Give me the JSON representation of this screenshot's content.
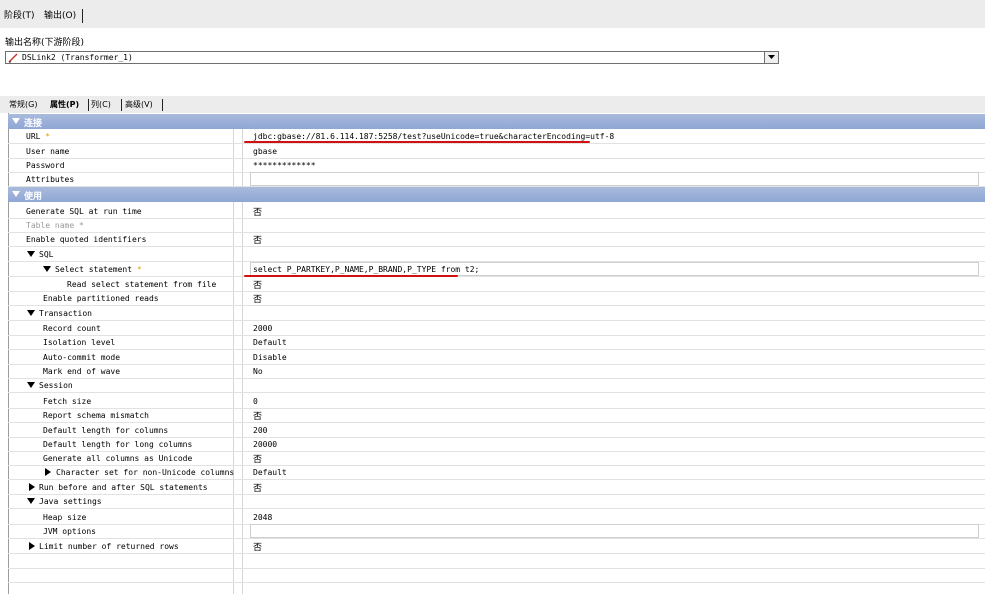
{
  "stage_tabs": [
    {
      "label": "阶段(T)"
    },
    {
      "label": "输出(O)"
    }
  ],
  "output_name_label": "输出名称(下游阶段)",
  "output_select_value": "DSLink2 (Transformer_1)",
  "property_tabs": [
    {
      "label": "常规(G)"
    },
    {
      "label": "属性(P)"
    },
    {
      "label": "列(C)"
    },
    {
      "label": "高级(V)"
    }
  ],
  "sections": {
    "connection": "连接",
    "usage": "使用"
  },
  "connection_rows": [
    {
      "name": "URL",
      "required": "*",
      "value": "jdbc:gbase://81.6.114.187:5258/test?useUnicode=true&characterEncoding=utf-8"
    },
    {
      "name": "User name",
      "value": "gbase"
    },
    {
      "name": "Password",
      "value": "*************"
    },
    {
      "name": "Attributes",
      "value": ""
    }
  ],
  "usage_rows": [
    {
      "name": "Generate SQL at run time",
      "value": "否"
    },
    {
      "name": "Table name",
      "required": "*",
      "value": ""
    },
    {
      "name": "Enable quoted identifiers",
      "value": "否"
    },
    {
      "name": "SQL",
      "value": ""
    },
    {
      "name": "Select statement",
      "required": "*",
      "value": "select P_PARTKEY,P_NAME,P_BRAND,P_TYPE from t2;"
    },
    {
      "name": "Read select statement from file",
      "value": "否"
    },
    {
      "name": "Enable partitioned reads",
      "value": "否"
    },
    {
      "name": "Transaction",
      "value": ""
    },
    {
      "name": "Record count",
      "value": "2000"
    },
    {
      "name": "Isolation level",
      "value": "Default"
    },
    {
      "name": "Auto-commit mode",
      "value": "Disable"
    },
    {
      "name": "Mark end of wave",
      "value": "No"
    },
    {
      "name": "Session",
      "value": ""
    },
    {
      "name": "Fetch size",
      "value": "0"
    },
    {
      "name": "Report schema mismatch",
      "value": "否"
    },
    {
      "name": "Default length for columns",
      "value": "200"
    },
    {
      "name": "Default length for long columns",
      "value": "20000"
    },
    {
      "name": "Generate all columns as Unicode",
      "value": "否"
    },
    {
      "name": "Character set for non-Unicode columns",
      "value": "Default"
    },
    {
      "name": "Run before and after SQL statements",
      "value": "否"
    },
    {
      "name": "Java settings",
      "value": ""
    },
    {
      "name": "Heap size",
      "value": "2048"
    },
    {
      "name": "JVM options",
      "value": ""
    },
    {
      "name": "Limit number of returned rows",
      "value": "否"
    }
  ],
  "icons": {
    "expanded": "triangle-down-icon",
    "collapsed": "triangle-right-icon",
    "dropdown": "chevron-down-icon",
    "link": "pencil-link-icon"
  },
  "colors": {
    "section_header": "#8fa6d4",
    "required_marker": "#e8a200",
    "annotation_underline": "#d31010"
  }
}
